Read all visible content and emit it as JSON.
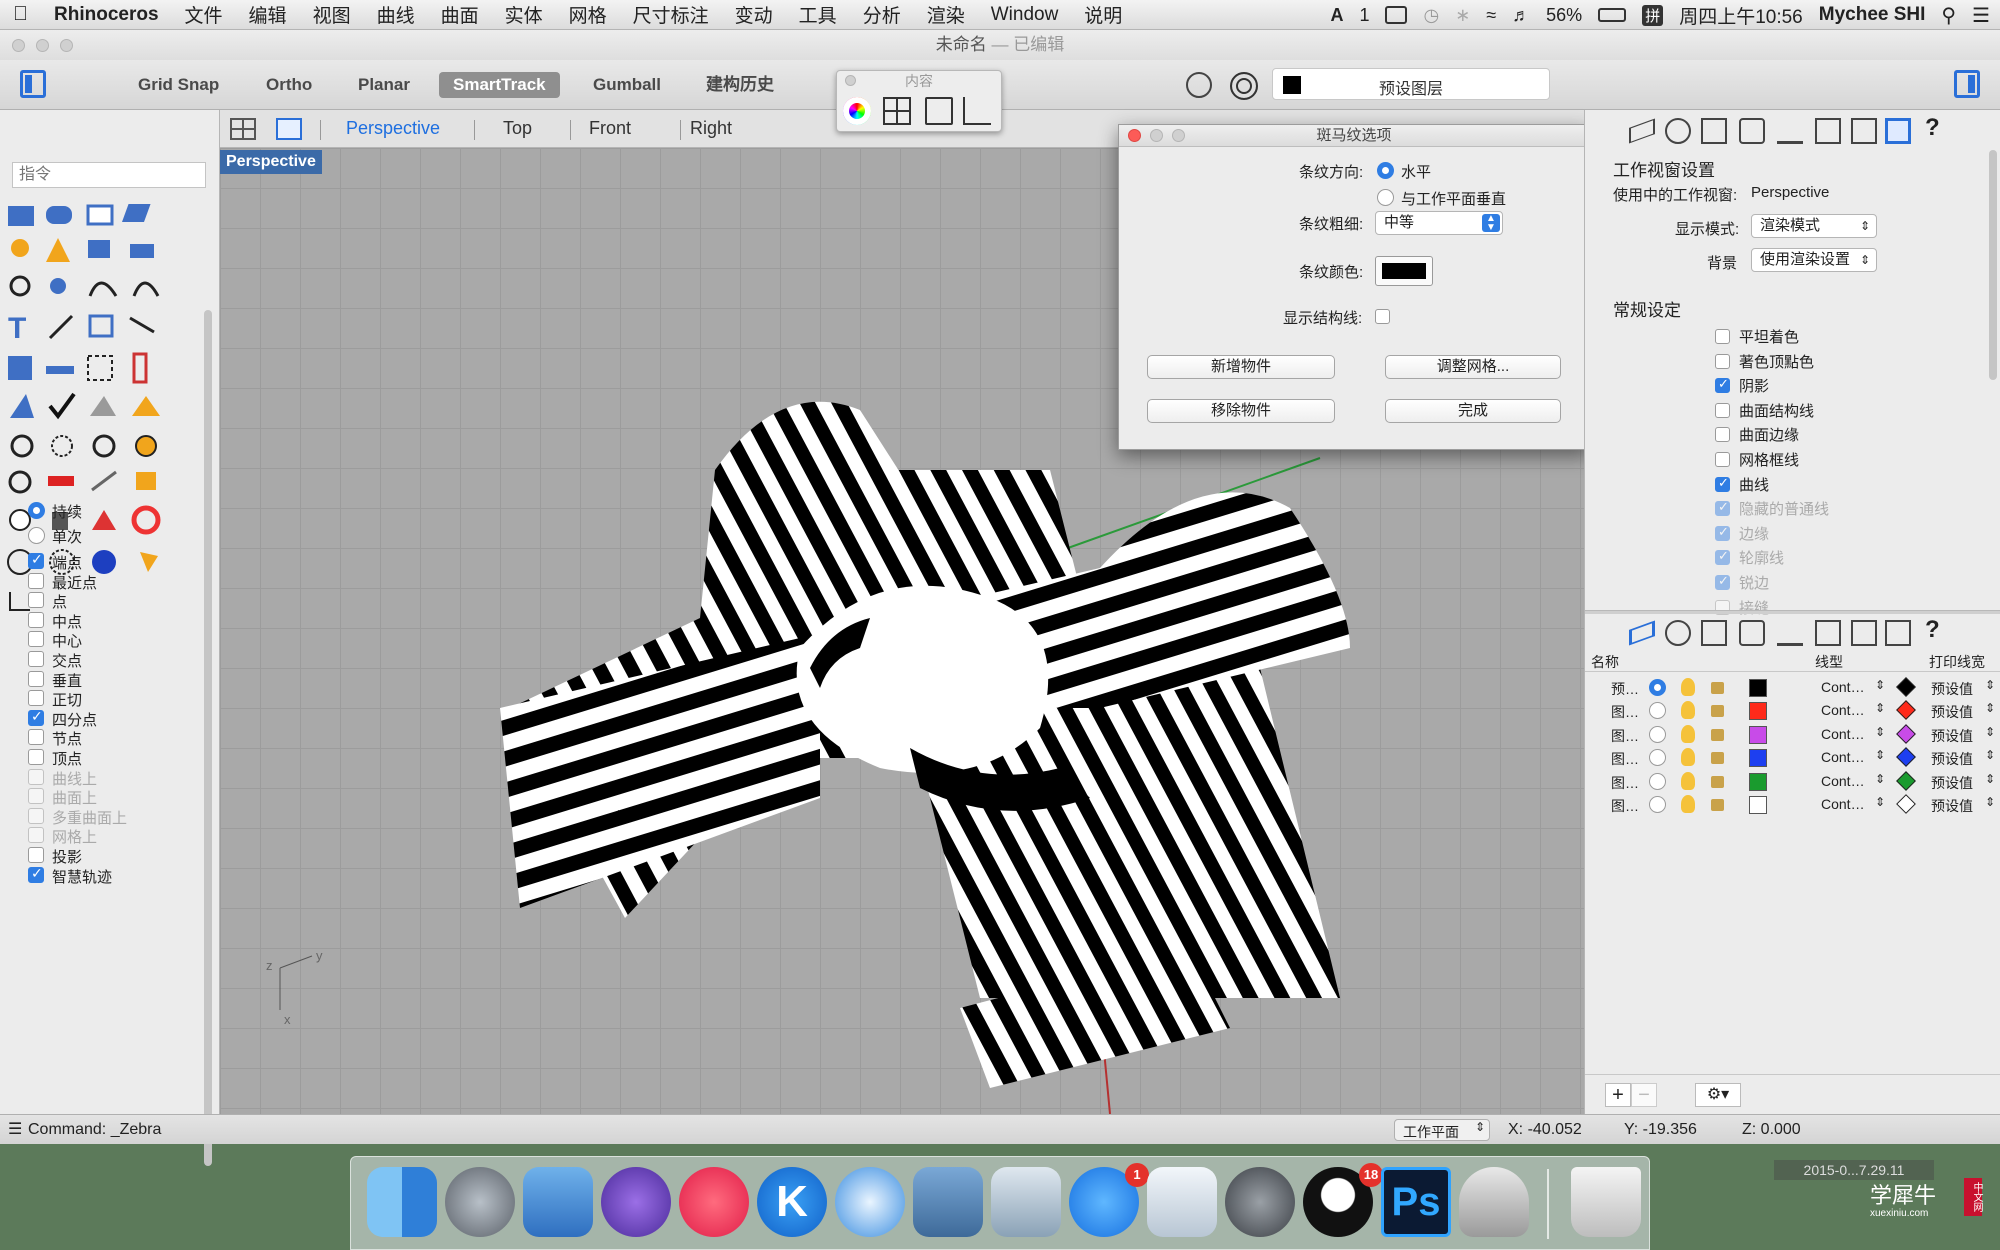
{
  "menubar": {
    "app": "Rhinoceros",
    "items": [
      "文件",
      "编辑",
      "视图",
      "曲线",
      "曲面",
      "实体",
      "网格",
      "尺寸标注",
      "变动",
      "工具",
      "分析",
      "渲染",
      "Window",
      "说明"
    ],
    "input_indicator": "1",
    "battery": "56%",
    "input_method": "拼",
    "clock": "周四上午10:56",
    "user": "Mychee SHI"
  },
  "window": {
    "title": "未命名",
    "subtitle": "— 已编辑"
  },
  "toolbar": {
    "buttons": [
      "Grid Snap",
      "Ortho",
      "Planar",
      "SmartTrack",
      "Gumball",
      "建构历史"
    ],
    "active": "SmartTrack",
    "layer_label": "预设图层"
  },
  "content_palette": {
    "title": "内容"
  },
  "view_tabs": {
    "tabs": [
      "Perspective",
      "Top",
      "Front",
      "Right"
    ],
    "active": "Perspective"
  },
  "left_panel": {
    "command_placeholder": "指令",
    "snap_mode": [
      {
        "label": "持续",
        "selected": true
      },
      {
        "label": "单次",
        "selected": false
      }
    ],
    "osnaps": [
      {
        "label": "端点",
        "checked": true,
        "disabled": false
      },
      {
        "label": "最近点",
        "checked": false,
        "disabled": false
      },
      {
        "label": "点",
        "checked": false,
        "disabled": false
      },
      {
        "label": "中点",
        "checked": false,
        "disabled": false
      },
      {
        "label": "中心",
        "checked": false,
        "disabled": false
      },
      {
        "label": "交点",
        "checked": false,
        "disabled": false
      },
      {
        "label": "垂直",
        "checked": false,
        "disabled": false
      },
      {
        "label": "正切",
        "checked": false,
        "disabled": false
      },
      {
        "label": "四分点",
        "checked": true,
        "disabled": false
      },
      {
        "label": "节点",
        "checked": false,
        "disabled": false
      },
      {
        "label": "顶点",
        "checked": false,
        "disabled": false
      },
      {
        "label": "曲线上",
        "checked": false,
        "disabled": true
      },
      {
        "label": "曲面上",
        "checked": false,
        "disabled": true
      },
      {
        "label": "多重曲面上",
        "checked": false,
        "disabled": true
      },
      {
        "label": "网格上",
        "checked": false,
        "disabled": true
      },
      {
        "label": "投影",
        "checked": false,
        "disabled": false
      },
      {
        "label": "智慧轨迹",
        "checked": true,
        "disabled": false
      }
    ]
  },
  "viewport": {
    "label": "Perspective",
    "axis_x": "x",
    "axis_y": "y",
    "axis_z": "z"
  },
  "zebra_dialog": {
    "title": "斑马纹选项",
    "direction_label": "条纹方向:",
    "direction_options": [
      {
        "label": "水平",
        "selected": true
      },
      {
        "label": "与工作平面垂直",
        "selected": false
      }
    ],
    "thickness_label": "条纹粗细:",
    "thickness_value": "中等",
    "color_label": "条纹颜色:",
    "stripe_color": "#000000",
    "show_iso_label": "显示结构线:",
    "btn_add": "新增物件",
    "btn_adjust_mesh": "调整网格...",
    "btn_remove": "移除物件",
    "btn_done": "完成"
  },
  "properties": {
    "heading": "工作视窗设置",
    "active_view_label": "使用中的工作视窗:",
    "active_view_value": "Perspective",
    "display_mode_label": "显示模式:",
    "display_mode_value": "渲染模式",
    "background_label": "背景",
    "background_value": "使用渲染设置",
    "general_heading": "常规设定",
    "options": [
      {
        "label": "平坦着色",
        "checked": false,
        "disabled": false
      },
      {
        "label": "著色顶點色",
        "checked": false,
        "disabled": false
      },
      {
        "label": "阴影",
        "checked": true,
        "disabled": false
      },
      {
        "label": "曲面结构线",
        "checked": false,
        "disabled": false
      },
      {
        "label": "曲面边缘",
        "checked": false,
        "disabled": false
      },
      {
        "label": "网格框线",
        "checked": false,
        "disabled": false
      },
      {
        "label": "曲线",
        "checked": true,
        "disabled": false
      },
      {
        "label": "隐藏的普通线",
        "checked": true,
        "disabled": true
      },
      {
        "label": "边缘",
        "checked": true,
        "disabled": true
      },
      {
        "label": "轮廓线",
        "checked": true,
        "disabled": true
      },
      {
        "label": "锐边",
        "checked": true,
        "disabled": true
      },
      {
        "label": "接缝",
        "checked": false,
        "disabled": true
      }
    ]
  },
  "layers": {
    "col_name": "名称",
    "col_linetype": "线型",
    "col_printwidth": "打印线宽",
    "rows": [
      {
        "name": "预…",
        "current": true,
        "color": "#000000",
        "linetype": "Cont…",
        "width": "预设值"
      },
      {
        "name": "图…",
        "current": false,
        "color": "#ff2a1a",
        "linetype": "Cont…",
        "width": "预设值"
      },
      {
        "name": "图…",
        "current": false,
        "color": "#c84be8",
        "linetype": "Cont…",
        "width": "预设值"
      },
      {
        "name": "图…",
        "current": false,
        "color": "#1d3ff0",
        "linetype": "Cont…",
        "width": "预设值"
      },
      {
        "name": "图…",
        "current": false,
        "color": "#1a9b2e",
        "linetype": "Cont…",
        "width": "预设值"
      },
      {
        "name": "图…",
        "current": false,
        "color": "#ffffff",
        "linetype": "Cont…",
        "width": "预设值"
      }
    ]
  },
  "statusbar": {
    "command": "Command: _Zebra",
    "cplane": "工作平面",
    "x": "X: -40.052",
    "y": "Y: -19.356",
    "z": "Z: 0.000"
  },
  "dock": {
    "apps": [
      "finder-icon",
      "launchpad-icon",
      "keynote-icon",
      "imovie-icon",
      "itunes-icon",
      "kuaibo-icon",
      "safari-icon",
      "iphoto-icon",
      "preview-icon",
      "app-store-icon",
      "directory-utility-icon",
      "system-preferences-icon",
      "qq-icon",
      "photoshop-icon",
      "rhino-icon",
      "trash-icon"
    ],
    "badge_appstore": "1",
    "badge_qq": "18",
    "photoshop_label": "Ps",
    "kuaibo_label": "K",
    "screenshot_label": "2015-0...7.29.11",
    "watermark": "学犀牛",
    "watermark_url": "xuexiniu.com",
    "watermark_badge": "中文网"
  }
}
